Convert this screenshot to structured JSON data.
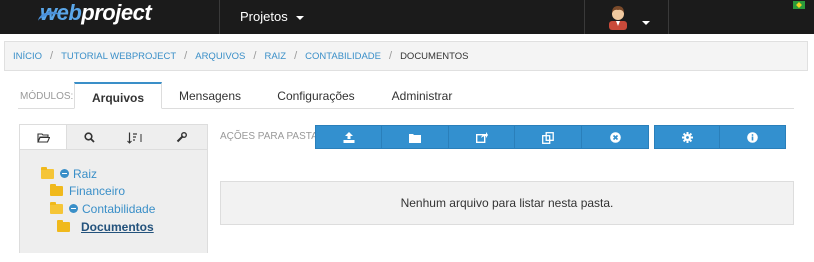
{
  "topbar": {
    "logo_web": "web",
    "logo_project": "project",
    "projects_label": "Projetos",
    "user": {
      "avatar_icon": "user-avatar-icon",
      "menu_icon": "chevron-down-icon"
    },
    "flag_icon": "brazil-flag-icon"
  },
  "breadcrumb": [
    {
      "label": "INÍCIO"
    },
    {
      "label": "TUTORIAL WEBPROJECT"
    },
    {
      "label": "ARQUIVOS"
    },
    {
      "label": "RAIZ"
    },
    {
      "label": "CONTABILIDADE"
    },
    {
      "label": "DOCUMENTOS",
      "current": true
    }
  ],
  "modules": {
    "label": "MÓDULOS:",
    "tabs": [
      {
        "label": "Arquivos",
        "active": true
      },
      {
        "label": "Mensagens"
      },
      {
        "label": "Configurações"
      },
      {
        "label": "Administrar"
      }
    ]
  },
  "panel": {
    "tabs": [
      {
        "icon": "folder-open-icon",
        "active": true
      },
      {
        "icon": "search-icon"
      },
      {
        "icon": "sort-icon"
      },
      {
        "icon": "wrench-icon"
      }
    ],
    "tree": [
      {
        "label": "Raiz",
        "icon": "folder-open-icon",
        "collapse_icon": "minus-circle-icon"
      },
      {
        "label": "Financeiro",
        "icon": "folder-icon"
      },
      {
        "label": "Contabilidade",
        "icon": "folder-open-icon",
        "collapse_icon": "minus-circle-icon"
      },
      {
        "label": "Documentos",
        "icon": "folder-icon",
        "current": true
      }
    ]
  },
  "actions": {
    "label": "AÇÕES PARA PASTA:",
    "buttons": [
      {
        "icon": "upload-icon"
      },
      {
        "icon": "folder-icon"
      },
      {
        "icon": "share-icon"
      },
      {
        "icon": "copy-icon"
      },
      {
        "icon": "close-circle-icon"
      },
      {
        "icon": "gear-icon"
      },
      {
        "icon": "info-icon"
      }
    ],
    "accent_color": "#3390cf"
  },
  "main": {
    "empty_message": "Nenhum arquivo para listar nesta pasta."
  }
}
